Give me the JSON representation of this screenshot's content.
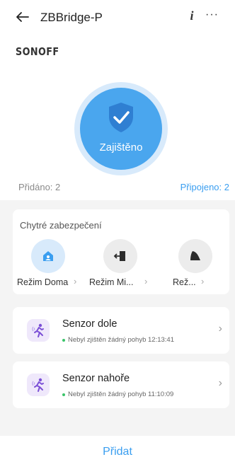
{
  "header": {
    "title": "ZBBridge-P",
    "info_icon": "i",
    "more_icon": "···"
  },
  "brand": {
    "text": "SONOFF"
  },
  "guard": {
    "label": "Zajištěno",
    "color": "#4aa6ee"
  },
  "stats": {
    "added": "Přidáno: 2",
    "connected": "Připojeno: 2"
  },
  "smart_security": {
    "title": "Chytré zabezpečení",
    "modes": [
      {
        "label": "Režim Doma",
        "icon": "home-shield-icon"
      },
      {
        "label": "Režim Mi...",
        "icon": "exit-door-icon"
      },
      {
        "label": "Rež...",
        "icon": "night-icon"
      }
    ]
  },
  "sensors": [
    {
      "name": "Senzor dole",
      "status": "Nebyl zjištěn žádný pohyb 12:13:41",
      "icon": "motion-icon"
    },
    {
      "name": "Senzor nahoře",
      "status": "Nebyl zjištěn žádný pohyb 11:10:09",
      "icon": "motion-icon"
    }
  ],
  "footer": {
    "add_label": "Přidat"
  },
  "colors": {
    "accent": "#3a9ef0",
    "status_ok": "#3bc46a"
  }
}
